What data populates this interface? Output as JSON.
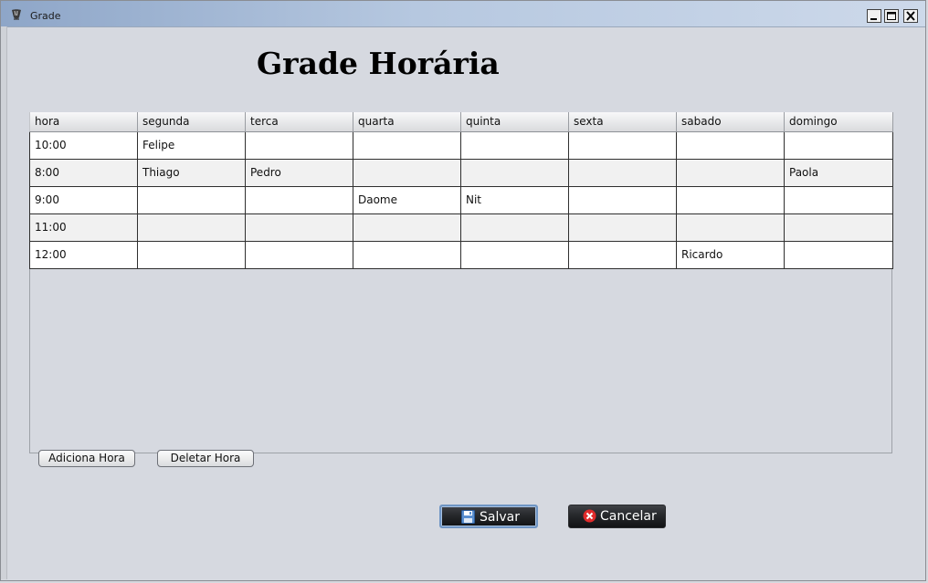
{
  "window": {
    "title": "Grade",
    "minimize_symbol": "minimize",
    "maximize_symbol": "maximize",
    "close_symbol": "close"
  },
  "heading": "Grade Horária",
  "table": {
    "columns": [
      "hora",
      "segunda",
      "terca",
      "quarta",
      "quinta",
      "sexta",
      "sabado",
      "domingo"
    ],
    "rows": [
      [
        "10:00",
        "Felipe",
        "",
        "",
        "",
        "",
        "",
        ""
      ],
      [
        "8:00",
        "Thiago",
        "Pedro",
        "",
        "",
        "",
        "",
        "Paola"
      ],
      [
        "9:00",
        "",
        "",
        "Daome",
        "Nit",
        "",
        "",
        ""
      ],
      [
        "11:00",
        "",
        "",
        "",
        "",
        "",
        "",
        ""
      ],
      [
        "12:00",
        "",
        "",
        "",
        "",
        "",
        "Ricardo",
        ""
      ]
    ]
  },
  "buttons": {
    "add_hour": "Adiciona Hora",
    "delete_hour": "Deletar Hora",
    "save": "Salvar",
    "cancel": "Cancelar"
  },
  "icons": {
    "app": "java-cup-icon",
    "save": "floppy-disk-icon",
    "cancel": "red-x-circle-icon"
  },
  "colors": {
    "save_focus_border": "#6f95c4",
    "cancel_icon": "#e02b2b",
    "save_icon": "#5a8fd0"
  }
}
